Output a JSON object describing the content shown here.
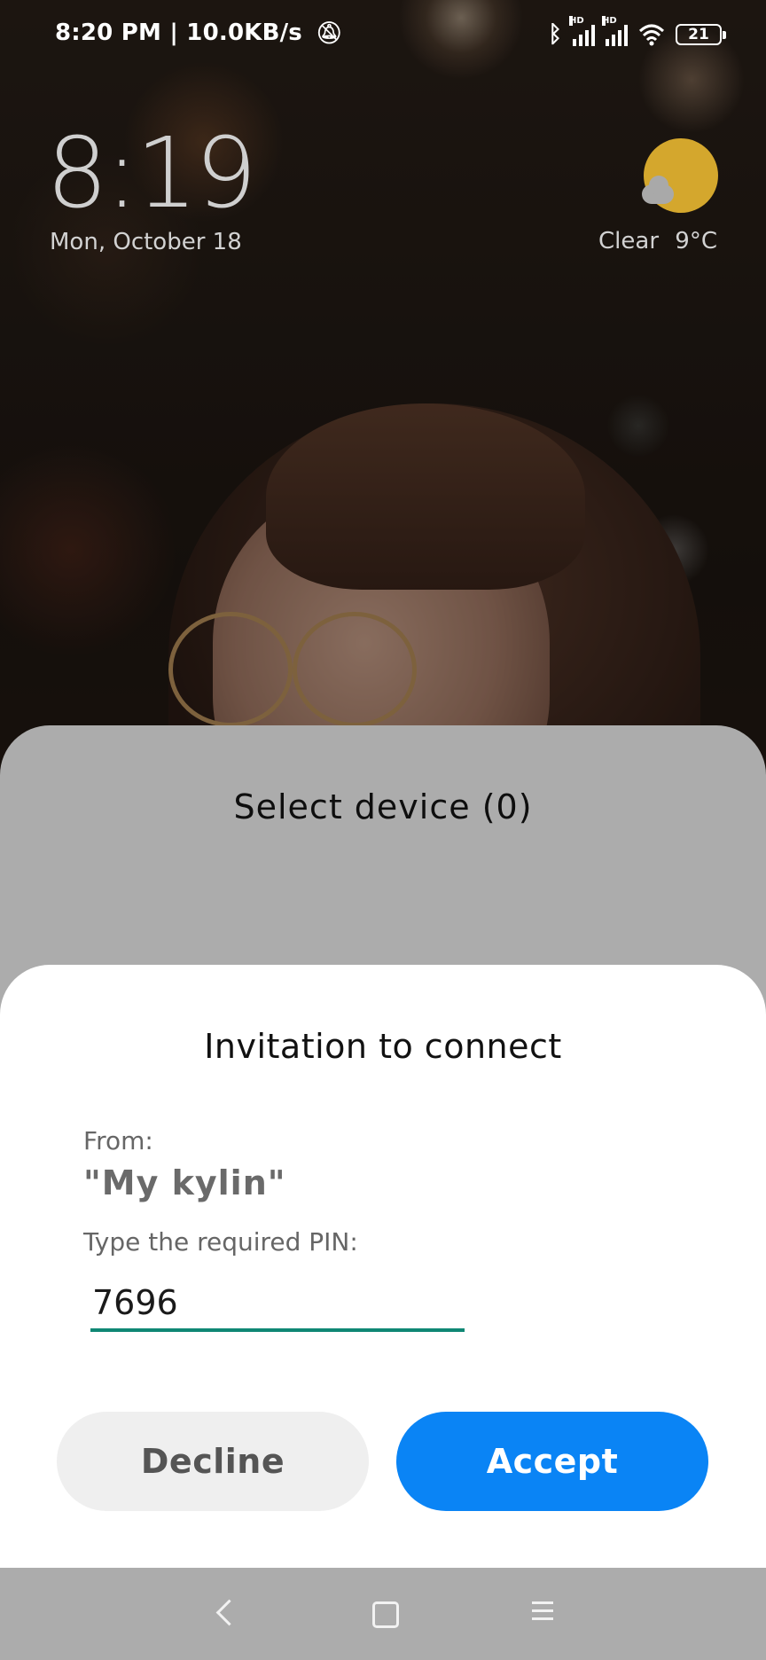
{
  "status_bar": {
    "time": "8:20 PM",
    "separator": "|",
    "network_speed": "10.0KB/s",
    "mute_icon": "bell-off-icon",
    "bluetooth_icon": "bluetooth-icon",
    "signal_badge_1": "HD",
    "signal_badge_2": "HD",
    "wifi_icon": "wifi-icon",
    "battery_level": "21"
  },
  "lock_screen": {
    "clock": "8:19",
    "date": "Mon, October 18",
    "weather_condition": "Clear",
    "temperature": "9°C"
  },
  "select_device": {
    "title": "Select device (0)"
  },
  "dialog": {
    "title": "Invitation to connect",
    "from_label": "From:",
    "from_value": "\"My kylin\"",
    "pin_label": "Type the required PIN:",
    "pin_value": "7696",
    "decline_label": "Decline",
    "accept_label": "Accept",
    "accent_color": "#0a84f5",
    "input_underline_color": "#0f8774"
  },
  "nav_bar": {
    "back": "back-icon",
    "home": "home-icon",
    "menu": "menu-icon"
  }
}
